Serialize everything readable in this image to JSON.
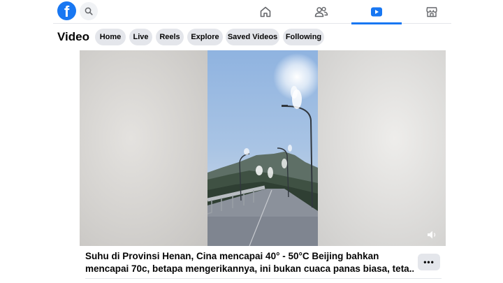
{
  "header": {
    "logo_letter": "f",
    "nav": [
      {
        "name": "home",
        "active": false
      },
      {
        "name": "friends",
        "active": false
      },
      {
        "name": "video",
        "active": true
      },
      {
        "name": "marketplace",
        "active": false
      }
    ]
  },
  "subnav": {
    "title": "Video",
    "pills": [
      "Home",
      "Live",
      "Reels",
      "Explore",
      "Saved Videos",
      "Following"
    ]
  },
  "post": {
    "caption_line1": "Suhu di Provinsi Henan, Cina mencapai 40° - 50°C Beijing bahkan",
    "caption_line2": "mencapai 70c, betapa mengerikannya, ini bukan cuaca panas biasa, teta...",
    "more_label": "•••"
  },
  "colors": {
    "accent": "#1877f2",
    "pill_bg": "#e4e6eb",
    "text": "#050505"
  }
}
